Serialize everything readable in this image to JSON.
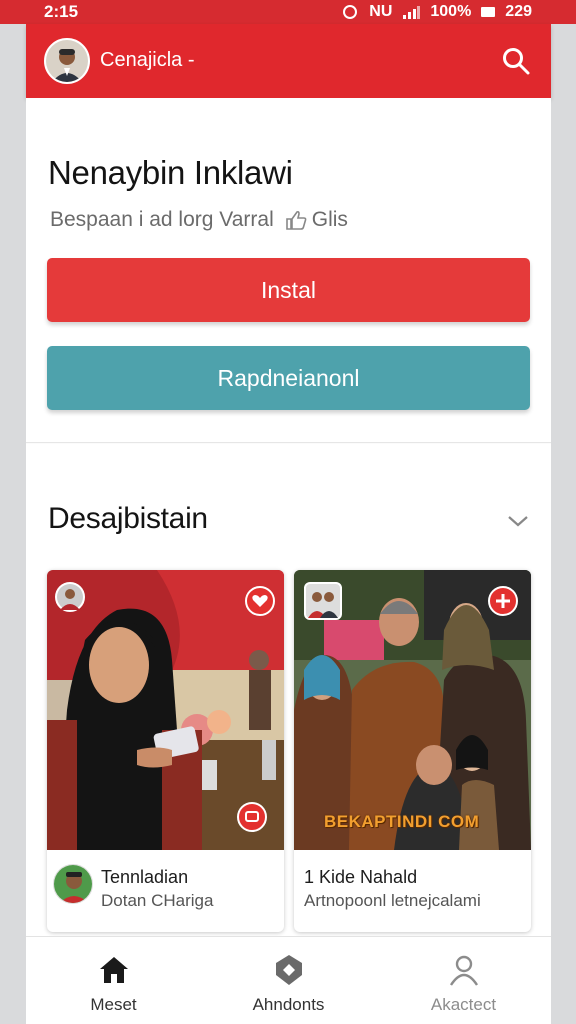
{
  "status_bar": {
    "time": "2:15",
    "icons_text": "NU",
    "battery": "100%",
    "right_time": "229"
  },
  "app_bar": {
    "title": "Cenajicla -",
    "avatar_icon": "profile-avatar",
    "search_icon": "search-icon"
  },
  "header_card": {
    "title": "Nenaybin Inklawi",
    "subtitle": "Bespaan i ad lorg Varral",
    "tag": "Glis",
    "install_label": "Instal",
    "second_label": "Rapdneianonl",
    "colors": {
      "install": "#e53a3a",
      "second": "#4ea2ac",
      "brand": "#e0282d"
    }
  },
  "section": {
    "title": "Desajbistain",
    "tiles": [
      {
        "name": "Tennladian",
        "sub": "Dotan CHariga"
      },
      {
        "name": "1 Kide Nahald",
        "sub": "Artnopoonl letnejcalami",
        "watermark": "BEKAPTINDI COM"
      }
    ]
  },
  "bottom_nav": {
    "items": [
      {
        "label": "Meset",
        "icon": "home-icon"
      },
      {
        "label": "Ahndonts",
        "icon": "shield-icon"
      },
      {
        "label": "Akactect",
        "icon": "user-icon"
      }
    ]
  }
}
